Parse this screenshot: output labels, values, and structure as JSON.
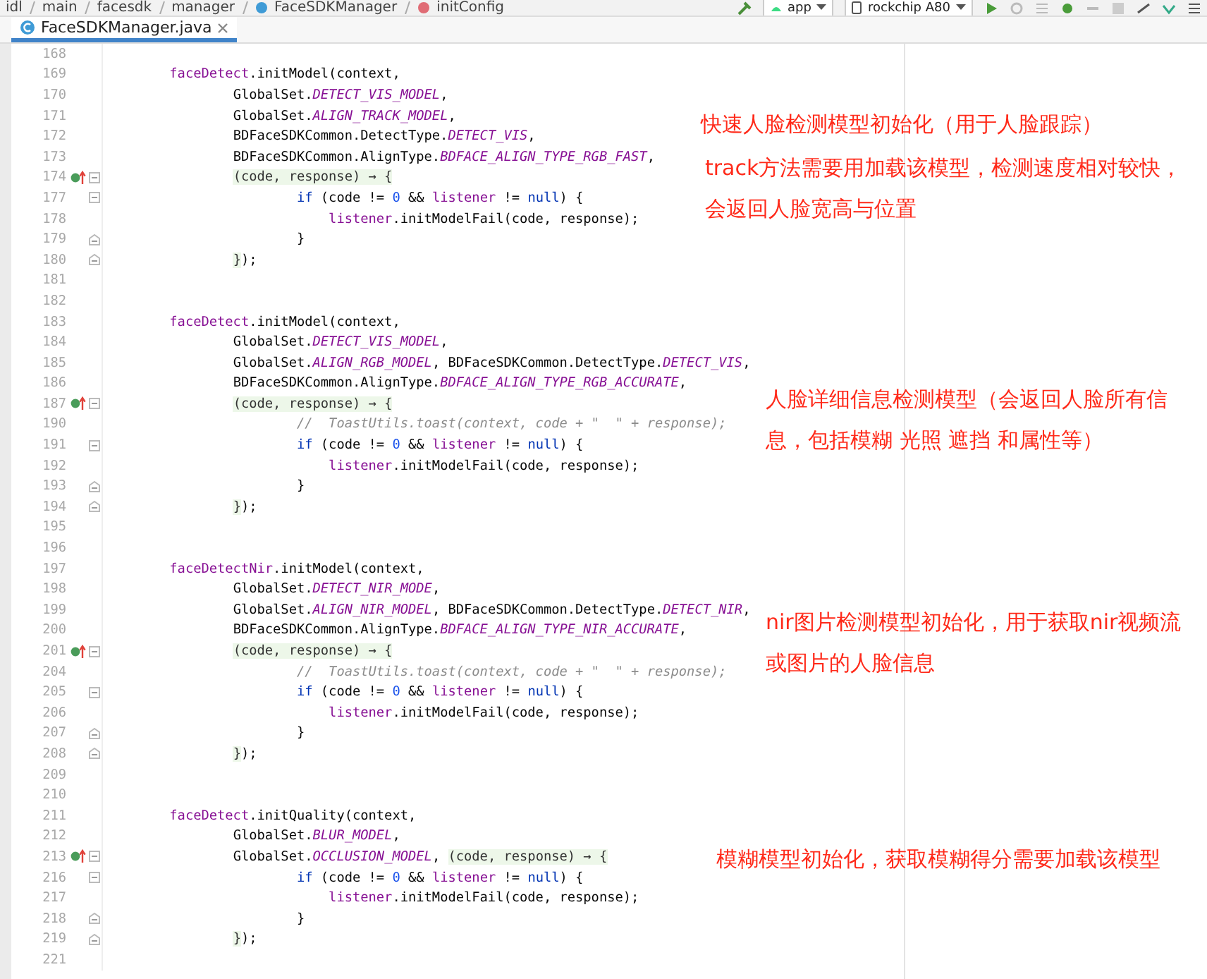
{
  "breadcrumb": [
    "idl",
    "main",
    "facesdk",
    "manager",
    "FaceSDKManager",
    "initConfig"
  ],
  "toolbar": {
    "module": "app",
    "device": "rockchip A80"
  },
  "tabs": [
    {
      "label": "FaceSDKManager.java",
      "selected": true
    }
  ],
  "lines": [
    {
      "number": "168"
    },
    {
      "number": "169",
      "tokens": [
        {
          "kind": "member",
          "text": "        faceDetect"
        },
        {
          "kind": "text",
          "text": ".initModel(context,"
        }
      ]
    },
    {
      "number": "170",
      "tokens": [
        {
          "kind": "text",
          "text": "                GlobalSet."
        },
        {
          "kind": "const",
          "text": "DETECT_VIS_MODEL"
        },
        {
          "kind": "text",
          "text": ","
        }
      ]
    },
    {
      "number": "171",
      "tokens": [
        {
          "kind": "text",
          "text": "                GlobalSet."
        },
        {
          "kind": "const",
          "text": "ALIGN_TRACK_MODEL"
        },
        {
          "kind": "text",
          "text": ","
        }
      ]
    },
    {
      "number": "172",
      "tokens": [
        {
          "kind": "text",
          "text": "                BDFaceSDKCommon.DetectType."
        },
        {
          "kind": "const",
          "text": "DETECT_VIS"
        },
        {
          "kind": "text",
          "text": ","
        }
      ]
    },
    {
      "number": "173",
      "tokens": [
        {
          "kind": "text",
          "text": "                BDFaceSDKCommon.AlignType."
        },
        {
          "kind": "const",
          "text": "BDFACE_ALIGN_TYPE_RGB_FAST"
        },
        {
          "kind": "text",
          "text": ","
        }
      ]
    },
    {
      "number": "174",
      "marker": true,
      "fold_open": true,
      "tokens": [
        {
          "kind": "lambda",
          "text": "                (code, response) → {"
        }
      ]
    },
    {
      "number": "177",
      "fold_open": true,
      "tokens": [
        {
          "kind": "keyword",
          "text": "                        if"
        },
        {
          "kind": "text",
          "text": " (code != "
        },
        {
          "kind": "number",
          "text": "0"
        },
        {
          "kind": "text",
          "text": " && "
        },
        {
          "kind": "member",
          "text": "listener"
        },
        {
          "kind": "text",
          "text": " != "
        },
        {
          "kind": "keyword",
          "text": "null"
        },
        {
          "kind": "text",
          "text": ") {"
        }
      ]
    },
    {
      "number": "178",
      "tokens": [
        {
          "kind": "member",
          "text": "                            listener"
        },
        {
          "kind": "text",
          "text": ".initModelFail(code, response);"
        }
      ]
    },
    {
      "number": "179",
      "fold_close": true,
      "tokens": [
        {
          "kind": "text",
          "text": "                        }"
        }
      ]
    },
    {
      "number": "180",
      "fold_close": true,
      "tokens": [
        {
          "kind": "lambda",
          "text": "                }"
        },
        {
          "kind": "text",
          "text": ");"
        }
      ]
    },
    {
      "number": "181"
    },
    {
      "number": "182"
    },
    {
      "number": "183",
      "tokens": [
        {
          "kind": "member",
          "text": "        faceDetect"
        },
        {
          "kind": "text",
          "text": ".initModel(context,"
        }
      ]
    },
    {
      "number": "184",
      "tokens": [
        {
          "kind": "text",
          "text": "                GlobalSet."
        },
        {
          "kind": "const",
          "text": "DETECT_VIS_MODEL"
        },
        {
          "kind": "text",
          "text": ","
        }
      ]
    },
    {
      "number": "185",
      "tokens": [
        {
          "kind": "text",
          "text": "                GlobalSet."
        },
        {
          "kind": "const",
          "text": "ALIGN_RGB_MODEL"
        },
        {
          "kind": "text",
          "text": ", BDFaceSDKCommon.DetectType."
        },
        {
          "kind": "const",
          "text": "DETECT_VIS"
        },
        {
          "kind": "text",
          "text": ","
        }
      ]
    },
    {
      "number": "186",
      "tokens": [
        {
          "kind": "text",
          "text": "                BDFaceSDKCommon.AlignType."
        },
        {
          "kind": "const",
          "text": "BDFACE_ALIGN_TYPE_RGB_ACCURATE"
        },
        {
          "kind": "text",
          "text": ","
        }
      ]
    },
    {
      "number": "187",
      "marker": true,
      "fold_open": true,
      "tokens": [
        {
          "kind": "lambda",
          "text": "                (code, response) → {"
        }
      ]
    },
    {
      "number": "190",
      "tokens": [
        {
          "kind": "comment",
          "text": "                        //  ToastUtils.toast(context, code + \"  \" + response);"
        }
      ]
    },
    {
      "number": "191",
      "fold_open": true,
      "tokens": [
        {
          "kind": "keyword",
          "text": "                        if"
        },
        {
          "kind": "text",
          "text": " (code != "
        },
        {
          "kind": "number",
          "text": "0"
        },
        {
          "kind": "text",
          "text": " && "
        },
        {
          "kind": "member",
          "text": "listener"
        },
        {
          "kind": "text",
          "text": " != "
        },
        {
          "kind": "keyword",
          "text": "null"
        },
        {
          "kind": "text",
          "text": ") {"
        }
      ]
    },
    {
      "number": "192",
      "tokens": [
        {
          "kind": "member",
          "text": "                            listener"
        },
        {
          "kind": "text",
          "text": ".initModelFail(code, response);"
        }
      ]
    },
    {
      "number": "193",
      "fold_close": true,
      "tokens": [
        {
          "kind": "text",
          "text": "                        }"
        }
      ]
    },
    {
      "number": "194",
      "fold_close": true,
      "tokens": [
        {
          "kind": "lambda",
          "text": "                }"
        },
        {
          "kind": "text",
          "text": ");"
        }
      ]
    },
    {
      "number": "195"
    },
    {
      "number": "196"
    },
    {
      "number": "197",
      "tokens": [
        {
          "kind": "member",
          "text": "        faceDetectNir"
        },
        {
          "kind": "text",
          "text": ".initModel(context,"
        }
      ]
    },
    {
      "number": "198",
      "tokens": [
        {
          "kind": "text",
          "text": "                GlobalSet."
        },
        {
          "kind": "const",
          "text": "DETECT_NIR_MODE"
        },
        {
          "kind": "text",
          "text": ","
        }
      ]
    },
    {
      "number": "199",
      "tokens": [
        {
          "kind": "text",
          "text": "                GlobalSet."
        },
        {
          "kind": "const",
          "text": "ALIGN_NIR_MODEL"
        },
        {
          "kind": "text",
          "text": ", BDFaceSDKCommon.DetectType."
        },
        {
          "kind": "const",
          "text": "DETECT_NIR"
        },
        {
          "kind": "text",
          "text": ","
        }
      ]
    },
    {
      "number": "200",
      "tokens": [
        {
          "kind": "text",
          "text": "                BDFaceSDKCommon.AlignType."
        },
        {
          "kind": "const",
          "text": "BDFACE_ALIGN_TYPE_NIR_ACCURATE"
        },
        {
          "kind": "text",
          "text": ","
        }
      ]
    },
    {
      "number": "201",
      "marker": true,
      "fold_open": true,
      "tokens": [
        {
          "kind": "lambda",
          "text": "                (code, response) → {"
        }
      ]
    },
    {
      "number": "204",
      "tokens": [
        {
          "kind": "comment",
          "text": "                        //  ToastUtils.toast(context, code + \"  \" + response);"
        }
      ]
    },
    {
      "number": "205",
      "fold_open": true,
      "tokens": [
        {
          "kind": "keyword",
          "text": "                        if"
        },
        {
          "kind": "text",
          "text": " (code != "
        },
        {
          "kind": "number",
          "text": "0"
        },
        {
          "kind": "text",
          "text": " && "
        },
        {
          "kind": "member",
          "text": "listener"
        },
        {
          "kind": "text",
          "text": " != "
        },
        {
          "kind": "keyword",
          "text": "null"
        },
        {
          "kind": "text",
          "text": ") {"
        }
      ]
    },
    {
      "number": "206",
      "tokens": [
        {
          "kind": "member",
          "text": "                            listener"
        },
        {
          "kind": "text",
          "text": ".initModelFail(code, response);"
        }
      ]
    },
    {
      "number": "207",
      "fold_close": true,
      "tokens": [
        {
          "kind": "text",
          "text": "                        }"
        }
      ]
    },
    {
      "number": "208",
      "fold_close": true,
      "tokens": [
        {
          "kind": "lambda",
          "text": "                }"
        },
        {
          "kind": "text",
          "text": ");"
        }
      ]
    },
    {
      "number": "209"
    },
    {
      "number": "210"
    },
    {
      "number": "211",
      "tokens": [
        {
          "kind": "member",
          "text": "        faceDetect"
        },
        {
          "kind": "text",
          "text": ".initQuality(context,"
        }
      ]
    },
    {
      "number": "212",
      "tokens": [
        {
          "kind": "text",
          "text": "                GlobalSet."
        },
        {
          "kind": "const",
          "text": "BLUR_MODEL"
        },
        {
          "kind": "text",
          "text": ","
        }
      ]
    },
    {
      "number": "213",
      "marker": true,
      "fold_open": true,
      "tokens": [
        {
          "kind": "text",
          "text": "                GlobalSet."
        },
        {
          "kind": "const",
          "text": "OCCLUSION_MODEL"
        },
        {
          "kind": "text",
          "text": ", "
        },
        {
          "kind": "lambda",
          "text": "(code, response) → {"
        }
      ]
    },
    {
      "number": "216",
      "fold_open": true,
      "tokens": [
        {
          "kind": "keyword",
          "text": "                        if"
        },
        {
          "kind": "text",
          "text": " (code != "
        },
        {
          "kind": "number",
          "text": "0"
        },
        {
          "kind": "text",
          "text": " && "
        },
        {
          "kind": "member",
          "text": "listener"
        },
        {
          "kind": "text",
          "text": " != "
        },
        {
          "kind": "keyword",
          "text": "null"
        },
        {
          "kind": "text",
          "text": ") {"
        }
      ]
    },
    {
      "number": "217",
      "tokens": [
        {
          "kind": "member",
          "text": "                            listener"
        },
        {
          "kind": "text",
          "text": ".initModelFail(code, response);"
        }
      ]
    },
    {
      "number": "218",
      "fold_close": true,
      "tokens": [
        {
          "kind": "text",
          "text": "                        }"
        }
      ]
    },
    {
      "number": "219",
      "fold_close": true,
      "tokens": [
        {
          "kind": "lambda",
          "text": "                }"
        },
        {
          "kind": "text",
          "text": ");"
        }
      ]
    },
    {
      "number": "221"
    }
  ],
  "annotations": [
    {
      "lines": [
        "快速人脸检测模型初始化（用于人脸跟踪）"
      ]
    },
    {
      "lines": [
        "track方法需要用加载该模型，检测速度相对较快，",
        "会返回人脸宽高与位置"
      ]
    },
    {
      "lines": [
        "人脸详细信息检测模型（会返回人脸所有信",
        "息，包括模糊 光照 遮挡 和属性等）"
      ]
    },
    {
      "lines": [
        "nir图片检测模型初始化，用于获取nir视频流",
        "或图片的人脸信息"
      ]
    },
    {
      "lines": [
        "模糊模型初始化，获取模糊得分需要加载该模型"
      ]
    }
  ]
}
